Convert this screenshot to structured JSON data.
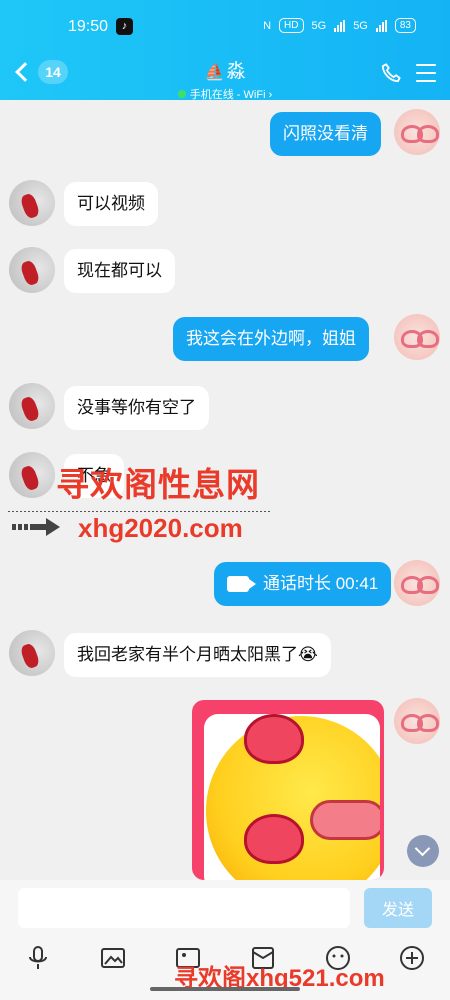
{
  "status_bar": {
    "time": "19:50",
    "nfc": "N",
    "hd": "HD",
    "g1": "5G",
    "g2": "5G",
    "battery": "83"
  },
  "header": {
    "back_count": "14",
    "contact_name": "淼",
    "status": "手机在线 - WiFi ›"
  },
  "messages": [
    {
      "side": "out",
      "text": "闪照没看清"
    },
    {
      "side": "in",
      "text": "可以视频"
    },
    {
      "side": "in",
      "text": "现在都可以"
    },
    {
      "side": "out",
      "text": "我这会在外边啊，姐姐"
    },
    {
      "side": "in",
      "text": "没事等你有空了"
    },
    {
      "side": "in",
      "text": "不急"
    },
    {
      "side": "out",
      "text": "通话时长 00:41"
    },
    {
      "side": "in",
      "text": "我回老家有半个月晒太阳黑了😭"
    }
  ],
  "watermarks": {
    "site_name": "寻欢阁性息网",
    "site_url": "xhg2020.com",
    "bottom": "寻欢阁xhg521.com"
  },
  "input": {
    "placeholder": "",
    "send_label": "发送"
  },
  "colors": {
    "header": "#14b3f5",
    "bubble_out": "#17a6f2",
    "bubble_in": "#ffffff",
    "watermark": "#e93a2a"
  },
  "icons": [
    "microphone-icon",
    "image-frame-icon",
    "gallery-icon",
    "red-packet-icon",
    "emoji-icon",
    "plus-icon"
  ]
}
